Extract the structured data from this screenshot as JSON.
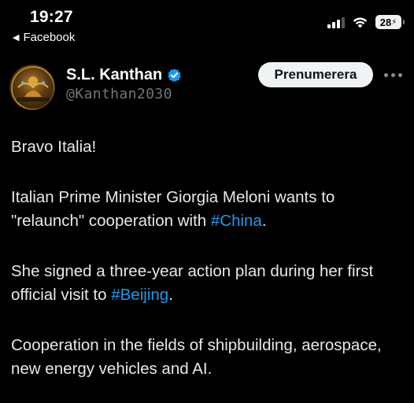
{
  "status_bar": {
    "time": "19:27",
    "back_app": "Facebook",
    "battery": "28",
    "signal_icon": "cellular-signal-icon",
    "wifi_icon": "wifi-icon"
  },
  "post": {
    "display_name": "S.L. Kanthan",
    "verified_icon": "verified-badge-icon",
    "handle": "@Kanthan2030",
    "subscribe_label": "Prenumerera",
    "more_icon": "ellipsis-icon",
    "paragraphs": [
      {
        "text": "Bravo Italia!"
      },
      {
        "pre": "Italian Prime Minister Giorgia Meloni wants to \"relaunch\" cooperation with ",
        "tag": "#China",
        "post": "."
      },
      {
        "pre": "She signed a three-year action plan during her first official visit to ",
        "tag": "#Beijing",
        "post": "."
      },
      {
        "text": "Cooperation in the fields of shipbuilding, aerospace, new energy vehicles and AI."
      }
    ]
  },
  "colors": {
    "background": "#000000",
    "text": "#e7e9ea",
    "secondary_text": "#71767b",
    "link": "#1d9bf0",
    "verified": "#1d9bf0"
  }
}
